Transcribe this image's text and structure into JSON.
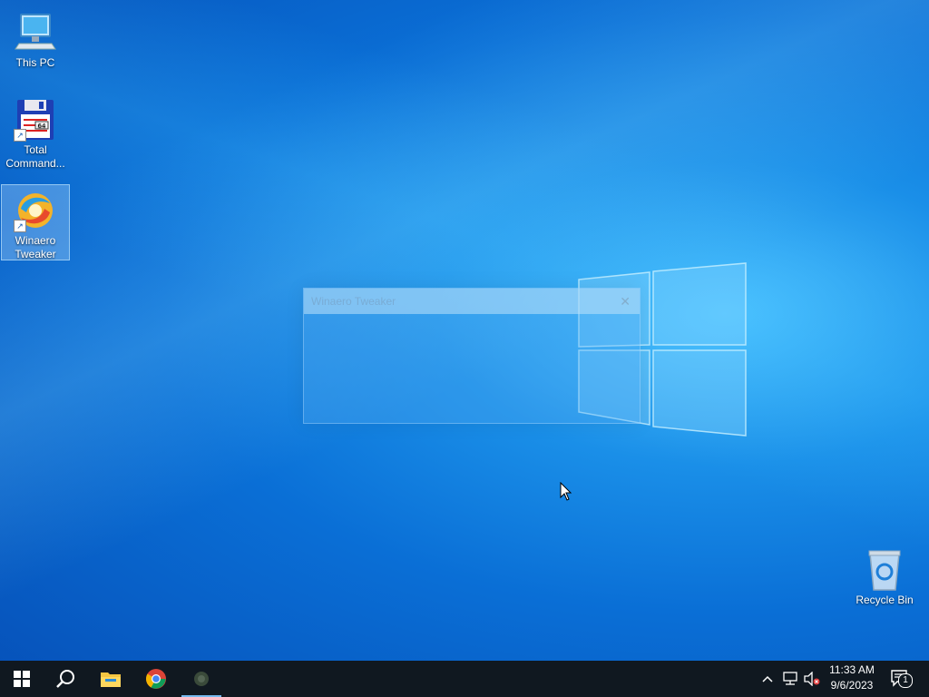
{
  "desktop": {
    "icons": [
      {
        "label": "This PC"
      },
      {
        "label": "Total Command..."
      },
      {
        "label": "Winaero Tweaker"
      },
      {
        "label": "Recycle Bin"
      }
    ]
  },
  "window": {
    "title": "Winaero Tweaker",
    "close_glyph": "✕"
  },
  "taskbar": {
    "clock_time": "11:33 AM",
    "clock_date": "9/6/2023",
    "notification_count": "1",
    "apps": [
      "start-icon",
      "search-icon",
      "file-explorer-icon",
      "chrome-icon",
      "winaero-tweaker-icon"
    ]
  },
  "colors": {
    "taskbar": "#101820",
    "accent": "#76b9ed"
  }
}
